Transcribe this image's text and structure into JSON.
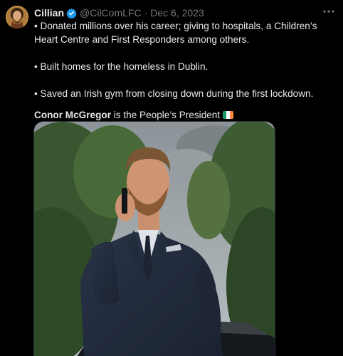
{
  "tweet": {
    "display_name": "Cillian",
    "handle": "@CilComLFC",
    "separator": "·",
    "date": "Dec 6, 2023",
    "lines": [
      "• Donated millions over his career; giving to hospitals, a Children’s Heart Centre and First Responders among others.",
      "• Built homes for the homeless in Dublin.",
      "• Saved an Irish gym from closing down during the first lockdown."
    ],
    "closing_bold": "Conor McGregor",
    "closing_rest": " is the People’s President"
  },
  "icons": {
    "verified": "verified-badge-icon",
    "more": "more-options-icon",
    "flag": "ireland-flag-emoji"
  },
  "colors": {
    "background": "#000000",
    "text": "#e7e9ea",
    "muted": "#71767b",
    "verified": "#1d9bf0",
    "flag_green": "#169b62",
    "flag_white": "#ffffff",
    "flag_orange": "#ff883e"
  }
}
